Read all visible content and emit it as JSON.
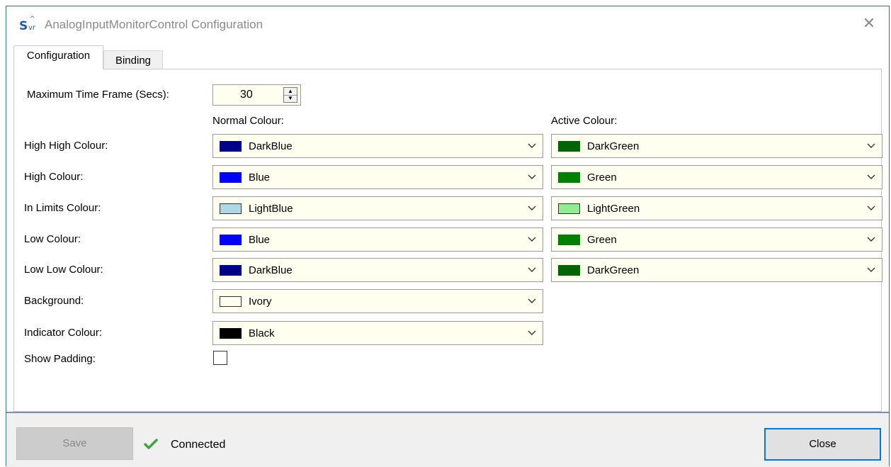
{
  "window": {
    "title": "AnalogInputMonitorControl Configuration",
    "close_glyph": "✕"
  },
  "tabs": [
    {
      "label": "Configuration",
      "active": true
    },
    {
      "label": "Binding",
      "active": false
    }
  ],
  "config": {
    "max_time_label": "Maximum Time Frame (Secs):",
    "max_time_value": "30",
    "normal_header": "Normal Colour:",
    "active_header": "Active Colour:",
    "rows": [
      {
        "label": "High High Colour:",
        "normal": {
          "name": "DarkBlue",
          "color": "#00008b"
        },
        "active": {
          "name": "DarkGreen",
          "color": "#006400"
        }
      },
      {
        "label": "High Colour:",
        "normal": {
          "name": "Blue",
          "color": "#0000ff"
        },
        "active": {
          "name": "Green",
          "color": "#008000"
        }
      },
      {
        "label": "In Limits Colour:",
        "normal": {
          "name": "LightBlue",
          "color": "#add8e6"
        },
        "active": {
          "name": "LightGreen",
          "color": "#90ee90"
        }
      },
      {
        "label": "Low Colour:",
        "normal": {
          "name": "Blue",
          "color": "#0000ff"
        },
        "active": {
          "name": "Green",
          "color": "#008000"
        }
      },
      {
        "label": "Low Low Colour:",
        "normal": {
          "name": "DarkBlue",
          "color": "#00008b"
        },
        "active": {
          "name": "DarkGreen",
          "color": "#006400"
        }
      }
    ],
    "background": {
      "label": "Background:",
      "name": "Ivory",
      "color": "#fffff0"
    },
    "indicator": {
      "label": "Indicator Colour:",
      "name": "Black",
      "color": "#000000"
    },
    "show_padding": {
      "label": "Show Padding:",
      "checked": false
    }
  },
  "footer": {
    "save_label": "Save",
    "status_text": "Connected",
    "close_label": "Close",
    "status_color": "#3aa83a",
    "accent_color": "#0078d7"
  }
}
